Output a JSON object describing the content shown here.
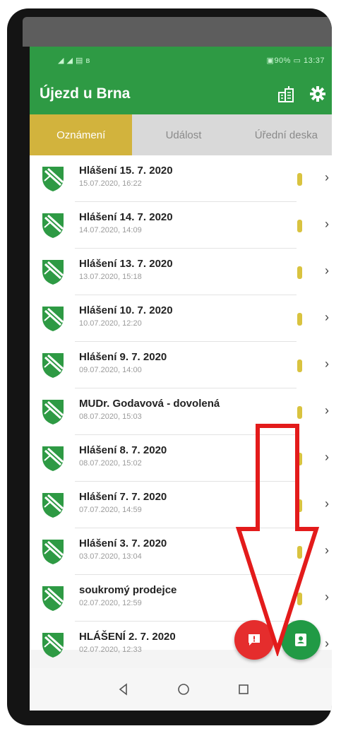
{
  "status_bar": {
    "left": "◢ ◢ ▤ ʙ",
    "right": "▣90% ▭ 13:37"
  },
  "app": {
    "title": "Újezd u Brna"
  },
  "tabs": [
    {
      "label": "Oznámení",
      "active": true
    },
    {
      "label": "Událost",
      "active": false
    },
    {
      "label": "Úřední deska",
      "active": false
    }
  ],
  "items": [
    {
      "title": "Hlášení 15. 7. 2020",
      "date": "15.07.2020, 16:22"
    },
    {
      "title": "Hlášení 14. 7. 2020",
      "date": "14.07.2020, 14:09"
    },
    {
      "title": "Hlášení 13. 7. 2020",
      "date": "13.07.2020, 15:18"
    },
    {
      "title": "Hlášení 10. 7. 2020",
      "date": "10.07.2020, 12:20"
    },
    {
      "title": "Hlášení 9. 7. 2020",
      "date": "09.07.2020, 14:00"
    },
    {
      "title": "MUDr. Godavová - dovolená",
      "date": "08.07.2020, 15:03"
    },
    {
      "title": "Hlášení 8. 7. 2020",
      "date": "08.07.2020, 15:02"
    },
    {
      "title": "Hlášení 7. 7. 2020",
      "date": "07.07.2020, 14:59"
    },
    {
      "title": "Hlášení 3. 7. 2020",
      "date": "03.07.2020, 13:04"
    },
    {
      "title": "soukromý prodejce",
      "date": "02.07.2020, 12:59"
    },
    {
      "title": "HLÁŠENÍ 2. 7. 2020",
      "date": "02.07.2020, 12:33"
    }
  ],
  "colors": {
    "brand_green": "#2e9a44",
    "tab_active": "#d2b33d",
    "flag": "#d9c33f",
    "fab_red": "#e52d2d",
    "fab_green": "#219a45",
    "arrow_red": "#e31b1b"
  },
  "icons": {
    "buildings": "city-hall-icon",
    "settings": "gear-icon",
    "item_logo": "coat-of-arms-icon",
    "chevron": "chevron-right-icon",
    "fab_red": "report-issue-icon",
    "fab_green": "contact-card-icon"
  }
}
